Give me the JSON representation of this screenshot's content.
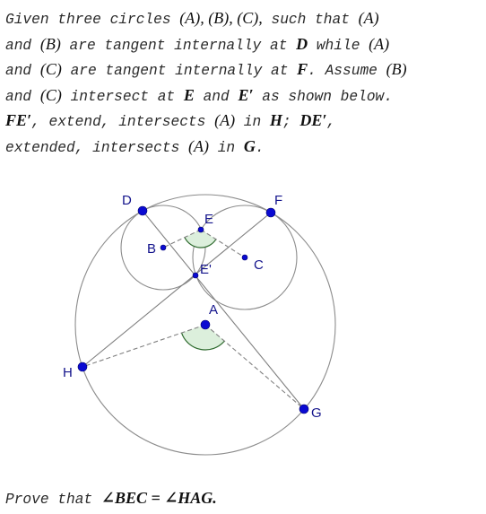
{
  "problem": {
    "lines": [
      [
        "Given three circles ",
        {
          "m": "(A), (B), (C),"
        },
        " such that ",
        {
          "m": "(A)"
        }
      ],
      [
        "and ",
        {
          "m": "(B)"
        },
        " are tangent internally at ",
        {
          "b": "D"
        },
        " while ",
        {
          "m": "(A)"
        }
      ],
      [
        "and ",
        {
          "m": "(C)"
        },
        " are tangent internally at ",
        {
          "b": "F"
        },
        ". Assume ",
        {
          "m": "(B)"
        }
      ],
      [
        "and ",
        {
          "m": "(C)"
        },
        " intersect at ",
        {
          "b": "E"
        },
        " and ",
        {
          "b": "E′"
        },
        " as shown below."
      ],
      [
        {
          "b": "FE′"
        },
        ", extend, intersects ",
        {
          "m": "(A)"
        },
        " in ",
        {
          "b": "H"
        },
        "; ",
        {
          "b": "DE′"
        },
        ","
      ],
      [
        "extended, intersects ",
        {
          "m": "(A)"
        },
        " in ",
        {
          "b": "G"
        },
        "."
      ]
    ]
  },
  "conclusion": {
    "prefix": "Prove that ",
    "statement": "∠BEC = ∠HAG."
  },
  "figure": {
    "colors": {
      "circle": "#8c8c8c",
      "segment": "#808080",
      "point": "#0a0ad2",
      "label": "#14148c",
      "angle_fill": "#dcefdc",
      "angle_stroke": "#2f6b2f"
    },
    "points": {
      "A": {
        "label": "A"
      },
      "B": {
        "label": "B"
      },
      "C": {
        "label": "C"
      },
      "D": {
        "label": "D"
      },
      "E": {
        "label": "E"
      },
      "E2": {
        "label": "E'"
      },
      "F": {
        "label": "F"
      },
      "G": {
        "label": "G"
      },
      "H": {
        "label": "H"
      }
    },
    "circles": [
      {
        "name": "circle-a",
        "center": "A"
      },
      {
        "name": "circle-b",
        "center": "B"
      },
      {
        "name": "circle-c",
        "center": "C"
      }
    ],
    "segments": [
      {
        "name": "segment-dg",
        "from": "D",
        "to": "G",
        "style": "solid"
      },
      {
        "name": "segment-fh",
        "from": "F",
        "to": "H",
        "style": "solid"
      },
      {
        "name": "segment-eb",
        "from": "E",
        "to": "B",
        "style": "dashed"
      },
      {
        "name": "segment-ec",
        "from": "E",
        "to": "C",
        "style": "dashed"
      },
      {
        "name": "segment-ah",
        "from": "A",
        "to": "H",
        "style": "dashed"
      },
      {
        "name": "segment-ag",
        "from": "A",
        "to": "G",
        "style": "dashed"
      }
    ],
    "angles": [
      {
        "name": "angle-bec",
        "vertex": "E",
        "from": "B",
        "to": "C"
      },
      {
        "name": "angle-hag",
        "vertex": "A",
        "from": "H",
        "to": "G"
      }
    ]
  }
}
